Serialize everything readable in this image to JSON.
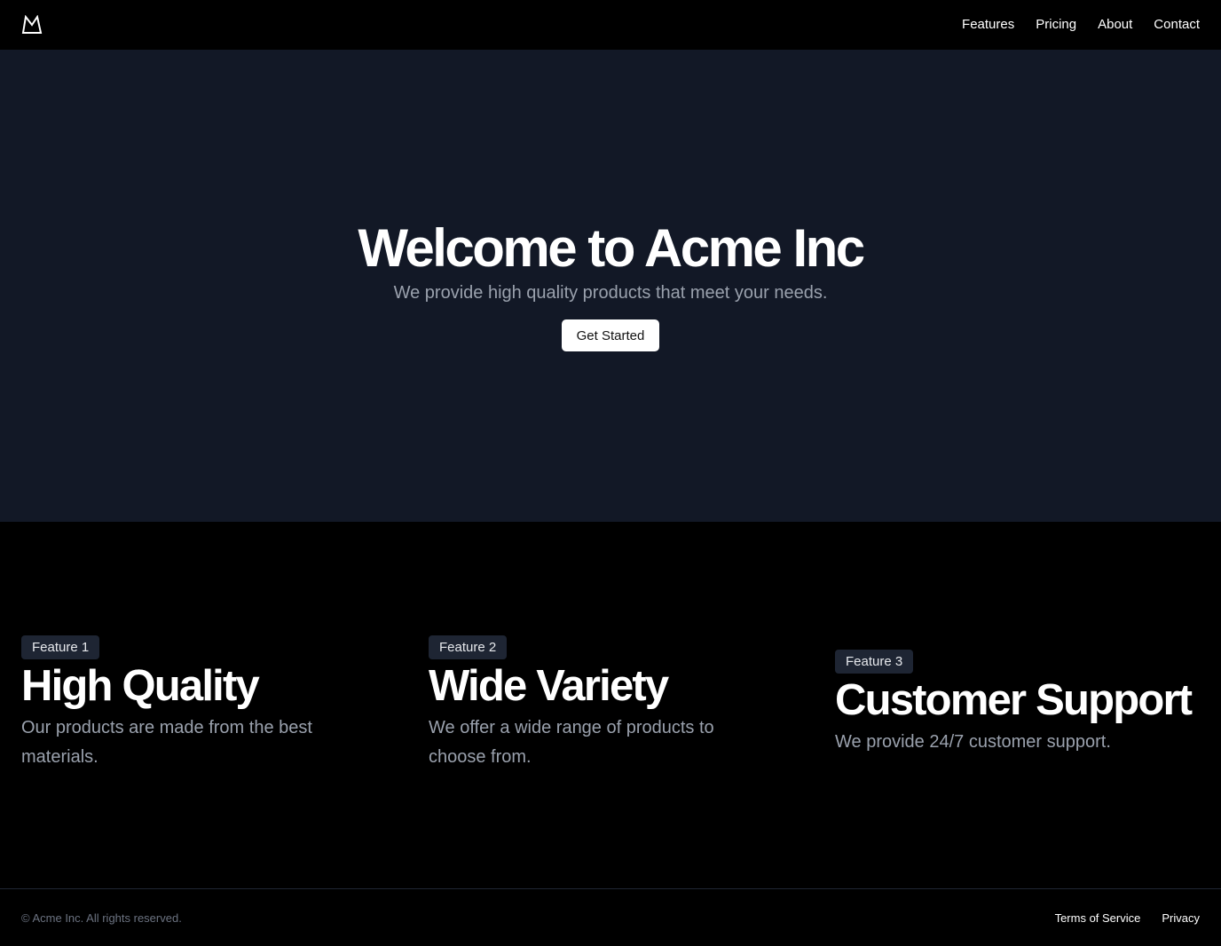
{
  "header": {
    "logo_icon": "mountain-icon",
    "nav": {
      "features": "Features",
      "pricing": "Pricing",
      "about": "About",
      "contact": "Contact"
    }
  },
  "hero": {
    "title": "Welcome to Acme Inc",
    "subtitle": "We provide high quality products that meet your needs.",
    "cta_label": "Get Started"
  },
  "features": [
    {
      "badge": "Feature 1",
      "title": "High Quality",
      "description": "Our products are made from the best materials."
    },
    {
      "badge": "Feature 2",
      "title": "Wide Variety",
      "description": "We offer a wide range of products to choose from."
    },
    {
      "badge": "Feature 3",
      "title": "Customer Support",
      "description": "We provide 24/7 customer support."
    }
  ],
  "footer": {
    "copyright": "© Acme Inc. All rights reserved.",
    "links": {
      "terms": "Terms of Service",
      "privacy": "Privacy"
    }
  },
  "colors": {
    "page_background": "#000000",
    "hero_background": "#121826",
    "muted_text": "#9aa1ad",
    "badge_background": "#1e2533",
    "button_background": "#ffffff"
  }
}
